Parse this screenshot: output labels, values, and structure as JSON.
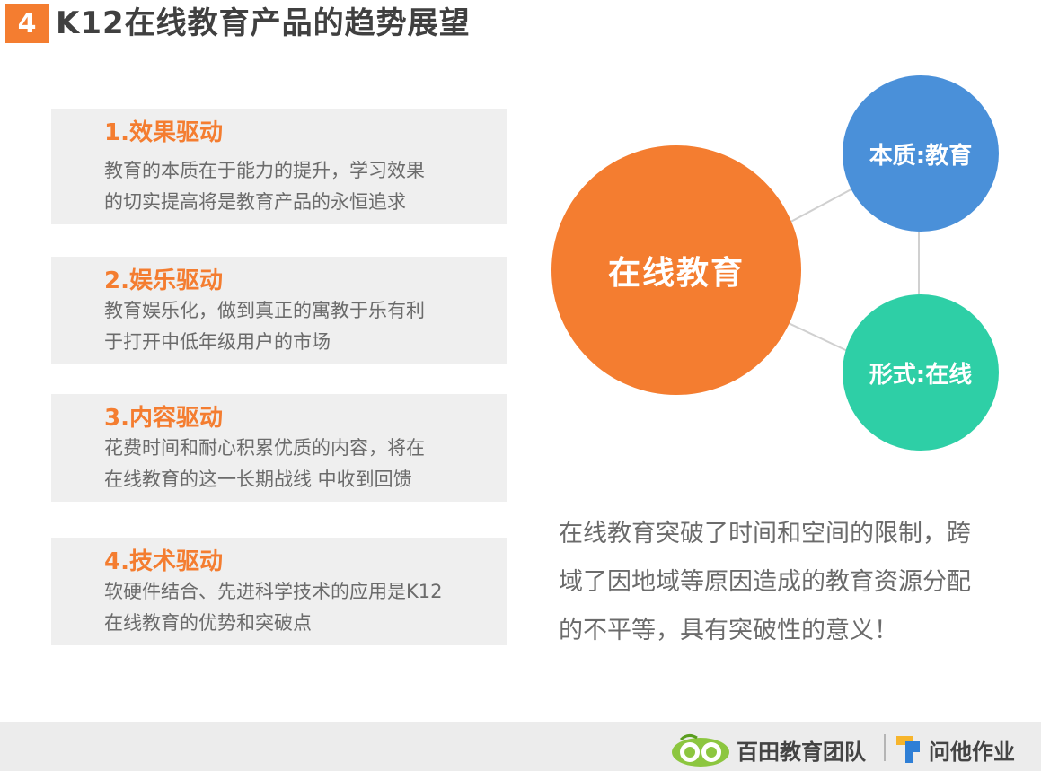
{
  "header": {
    "badge": "4",
    "title": "K12在线教育产品的趋势展望"
  },
  "drivers": [
    {
      "title": "1.效果驱动",
      "desc_line1": "教育的本质在于能力的提升，学习效果",
      "desc_line2": "的切实提高将是教育产品的永恒追求"
    },
    {
      "title": "2.娱乐驱动",
      "desc_line1": "教育娱乐化，做到真正的寓教于乐有利",
      "desc_line2": "于打开中低年级用户的市场"
    },
    {
      "title": "3.内容驱动",
      "desc_line1": "花费时间和耐心积累优质的内容，将在",
      "desc_line2": "在线教育的这一长期战线 中收到回馈"
    },
    {
      "title": "4.技术驱动",
      "desc_line1": "软硬件结合、先进科学技术的应用是K12",
      "desc_line2": "在线教育的优势和突破点"
    }
  ],
  "diagram": {
    "main_label": "在线教育",
    "essence_label": "本质:教育",
    "form_label": "形式:在线",
    "colors": {
      "main": "#f47d30",
      "essence": "#4a90d9",
      "form": "#2ecfa6"
    }
  },
  "summary": {
    "line1": "在线教育突破了时间和空间的限制，跨",
    "line2": "域了因地域等原因造成的教育资源分配",
    "line3": "的不平等，具有突破性的意义！"
  },
  "footer": {
    "team_name": "百田教育团队",
    "app_name": "问他作业"
  }
}
